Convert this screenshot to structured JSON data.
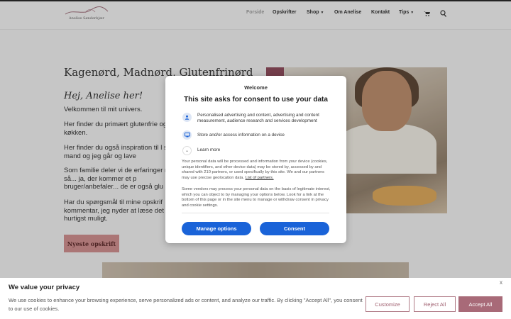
{
  "header": {
    "logo_text": "Anelise Sønderkjær",
    "nav": [
      {
        "label": "Forside",
        "active": true
      },
      {
        "label": "Opskrifter",
        "active": false
      },
      {
        "label": "Shop",
        "active": false,
        "dropdown": true
      },
      {
        "label": "Om Anelise",
        "active": false
      },
      {
        "label": "Kontakt",
        "active": false
      },
      {
        "label": "Tips",
        "active": false,
        "dropdown": true
      }
    ],
    "icons": [
      "cart-icon",
      "search-icon"
    ]
  },
  "page": {
    "heading": "Kagenørd, Madnørd, Glutenfrinørd",
    "greeting": "Hej, Anelise her!",
    "p1": "Velkommen til mit univers.",
    "p2": "Her finder du primært glutenfrie og søde køkken.",
    "p3": "Her finder du også inspiration til l som min mand og  jeg går og lave",
    "p4": "Som familie deler vi de erfaringer rejser og så... ja, der kommer et p bruger/anbefaler... de er også glu",
    "p5": "Har du spørgsmål til mine opskrif kommentar, jeg nyder at læse det tilbage hurtigst muligt.",
    "recipes_button": "Nyeste opskrift"
  },
  "consent_modal": {
    "welcome": "Welcome",
    "title": "This site asks for consent to use your data",
    "items": [
      {
        "icon": "person-icon",
        "text": "Personalised advertising and content, advertising and content measurement, audience research and services development"
      },
      {
        "icon": "device-icon",
        "text": "Store and/or access information on a device"
      }
    ],
    "learn_more": "Learn more",
    "body1": "Your personal data will be processed and information from your device (cookies, unique identifiers, and other device data) may be stored by, accessed by and shared with 210 partners, or used specifically by this site. We and our partners may use precise geolocation data.",
    "partners_link": "List of partners.",
    "body2": "Some vendors may process your personal data on the basis of legitimate interest, which you can object to by managing your options below. Look for a link at the bottom of this page or in the site menu to manage or withdraw consent in privacy and cookie settings.",
    "manage_button": "Manage options",
    "consent_button": "Consent"
  },
  "cookie_banner": {
    "title": "We value your privacy",
    "text": "We use cookies to enhance your browsing experience, serve personalized ads or content, and analyze our traffic. By clicking \"Accept All\", you consent to our use of cookies.",
    "close": "x",
    "customize": "Customize",
    "reject": "Reject All",
    "accept": "Accept All"
  },
  "colors": {
    "consent_blue": "#1a63d8",
    "brand_rose": "#a86a78",
    "recipes_button": "#c98b8b"
  }
}
